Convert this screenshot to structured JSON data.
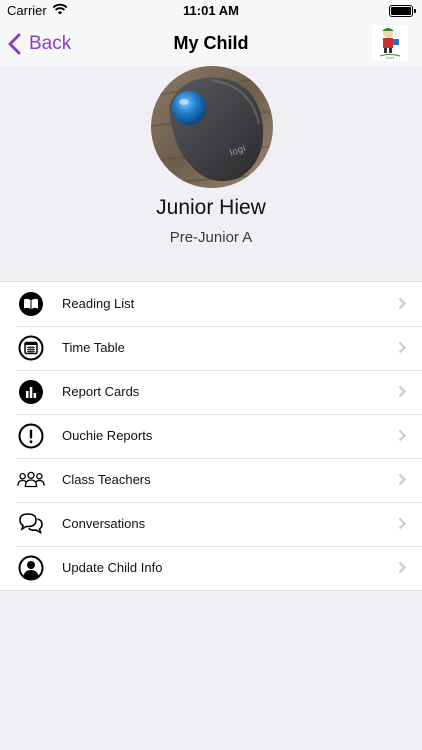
{
  "status_bar": {
    "carrier": "Carrier",
    "time": "11:01 AM"
  },
  "nav": {
    "back_label": "Back",
    "title": "My Child"
  },
  "child": {
    "name": "Junior Hiew",
    "class": "Pre-Junior A"
  },
  "menu": [
    {
      "label": "Reading List",
      "icon": "book-icon"
    },
    {
      "label": "Time Table",
      "icon": "calendar-icon"
    },
    {
      "label": "Report Cards",
      "icon": "bar-chart-icon"
    },
    {
      "label": "Ouchie Reports",
      "icon": "exclamation-icon"
    },
    {
      "label": "Class Teachers",
      "icon": "people-icon"
    },
    {
      "label": "Conversations",
      "icon": "chat-bubbles-icon"
    },
    {
      "label": "Update Child Info",
      "icon": "user-circle-icon"
    }
  ],
  "colors": {
    "accent": "#8a3fc4",
    "background": "#efeff4",
    "chevron": "#c7c7cc"
  }
}
